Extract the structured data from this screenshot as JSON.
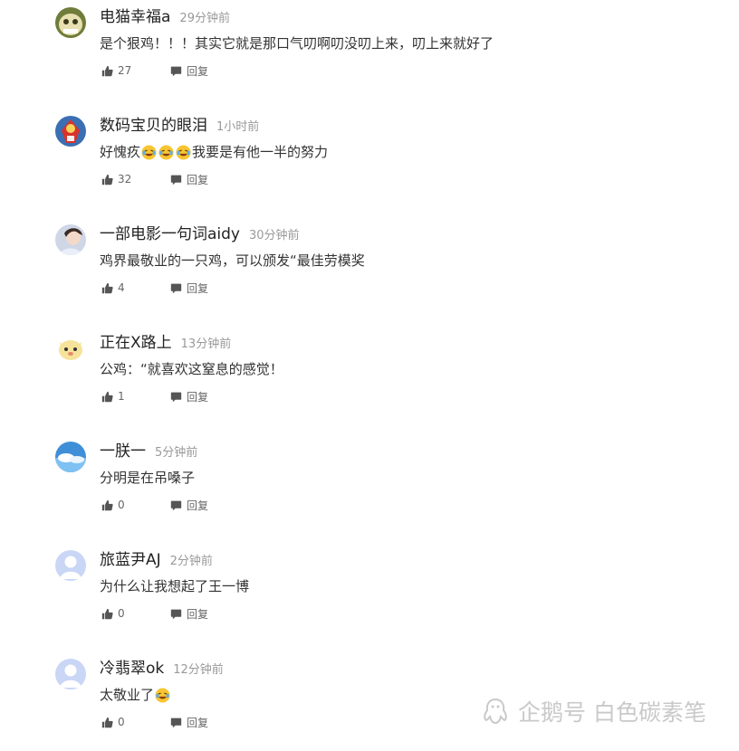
{
  "comments": [
    {
      "username": "电猫幸福a",
      "time": "29分钟前",
      "text_parts": [
        "是个狠鸡！！！其实它就是那口气叨啊叨没叨上来，叨上来就好了"
      ],
      "likes": "27",
      "reply_label": "回复",
      "avatar_style": "cartoon-cat"
    },
    {
      "username": "数码宝贝的眼泪",
      "time": "1小时前",
      "text_parts": [
        "好愧疚",
        "我要是有他一半的努力"
      ],
      "emoji_count": 3,
      "likes": "32",
      "reply_label": "回复",
      "avatar_style": "red-character"
    },
    {
      "username": "一部电影一句词aidy",
      "time": "30分钟前",
      "text_parts": [
        "鸡界最敬业的一只鸡，可以颁发“最佳劳模奖"
      ],
      "likes": "4",
      "reply_label": "回复",
      "avatar_style": "photo-girl"
    },
    {
      "username": "正在X路上",
      "time": "13分钟前",
      "text_parts": [
        "公鸡：“就喜欢这窒息的感觉！"
      ],
      "likes": "1",
      "reply_label": "回复",
      "avatar_style": "cartoon-yellow"
    },
    {
      "username": "一朕一",
      "time": "5分钟前",
      "text_parts": [
        "分明是在吊嗓子"
      ],
      "likes": "0",
      "reply_label": "回复",
      "avatar_style": "blue-sky"
    },
    {
      "username": "旅蓝尹AJ",
      "time": "2分钟前",
      "text_parts": [
        "为什么让我想起了王一博"
      ],
      "likes": "0",
      "reply_label": "回复",
      "avatar_style": "default"
    },
    {
      "username": "冷翡翠ok",
      "time": "12分钟前",
      "text_parts": [
        "太敬业了"
      ],
      "emoji_count": 1,
      "likes": "0",
      "reply_label": "回复",
      "avatar_style": "default"
    }
  ],
  "watermark": {
    "text": "企鹅号 白色碳素笔"
  },
  "colors": {
    "username": "#222222",
    "time": "#999999",
    "text": "#333333",
    "action": "#666666",
    "icon": "#555555",
    "default_avatar": "#c9d6f5",
    "watermark": "#c9c9c9"
  }
}
